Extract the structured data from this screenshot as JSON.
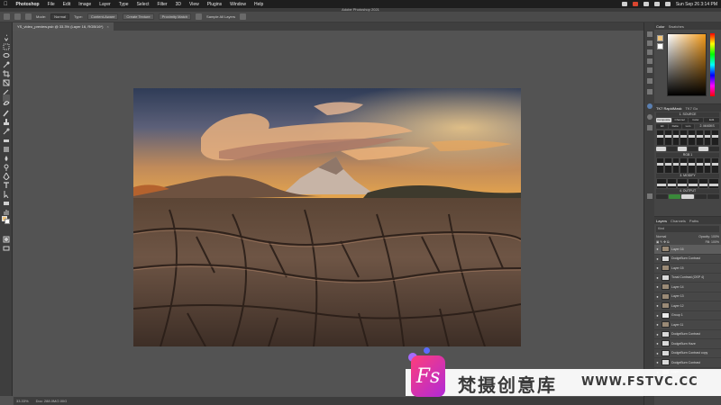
{
  "menubar": {
    "apple": "",
    "app": "Photoshop",
    "items": [
      "File",
      "Edit",
      "Image",
      "Layer",
      "Type",
      "Select",
      "Filter",
      "3D",
      "View",
      "Plugins",
      "Window",
      "Help"
    ],
    "clock": "Sun Sep 26  3:14 PM"
  },
  "window": {
    "title": "Adobe Photoshop 2021"
  },
  "options": {
    "mode_label": "Mode:",
    "mode_value": "Normal",
    "type_label": "Type:",
    "type_value": "Content-Aware",
    "create_texture": "Create Texture",
    "proximity_match": "Proximity Match",
    "sample_all": "Sample All Layers"
  },
  "document": {
    "tab": "YS_video_preview.psb @ 33.3% (Layer 16, RGB/16*)",
    "close": "×"
  },
  "status": {
    "zoom": "33.33%",
    "doc": "Doc: 288.0M/2.00G"
  },
  "color_panel": {
    "tabs": [
      "Color",
      "Swatches"
    ],
    "accent": "#f29a1a",
    "foreground": "#f2c57a"
  },
  "tk_panel": {
    "tabs": [
      "TK7 RapidMask",
      "TK7 Go"
    ],
    "source_label": "1. SOURCE",
    "masks_label": "2. MASKS",
    "modify_label": "3. MODIFY",
    "output_label": "4. OUTPUT",
    "composite_tabs": [
      "Composite",
      "Channel",
      "Color",
      "Edit"
    ],
    "mode_tabs": [
      "Elt",
      "Delta",
      "Lum"
    ],
    "rgb_label": "RGB 1"
  },
  "layers_panel": {
    "tabs": [
      "Layers",
      "Channels",
      "Paths"
    ],
    "search": "Kind",
    "blend": "Normal",
    "opacity_label": "Opacity: 100%",
    "fill_label": "Fill: 100%",
    "layers": [
      {
        "name": "Layer 16",
        "type": "pixel",
        "selected": true
      },
      {
        "name": "DodgeBurn Contrast",
        "type": "adj",
        "selected": false
      },
      {
        "name": "Layer 15",
        "type": "pixel",
        "selected": false
      },
      {
        "name": "Tonal Contrast (OSP 4)",
        "type": "adj",
        "selected": false
      },
      {
        "name": "Layer 14",
        "type": "pixel",
        "selected": false
      },
      {
        "name": "Layer 13",
        "type": "pixel",
        "selected": false
      },
      {
        "name": "Layer 12",
        "type": "pixel",
        "selected": false
      },
      {
        "name": "Group 1",
        "type": "group",
        "selected": false
      },
      {
        "name": "Layer 11",
        "type": "pixel",
        "selected": false
      },
      {
        "name": "DodgeBurn Contrast",
        "type": "adj",
        "selected": false
      },
      {
        "name": "DodgeBurn Haze",
        "type": "adj",
        "selected": false
      },
      {
        "name": "DodgeBurn Contrast copy",
        "type": "adj",
        "selected": false
      },
      {
        "name": "DodgeBurn Contrast",
        "type": "adj",
        "selected": false
      },
      {
        "name": "Layer 10",
        "type": "pixel",
        "selected": false
      },
      {
        "name": "Layer 9",
        "type": "pixel",
        "selected": false
      }
    ]
  },
  "watermark": {
    "logo": "Fs",
    "text": "梵摄创意库",
    "url": "WWW.FSTVC.CC"
  }
}
